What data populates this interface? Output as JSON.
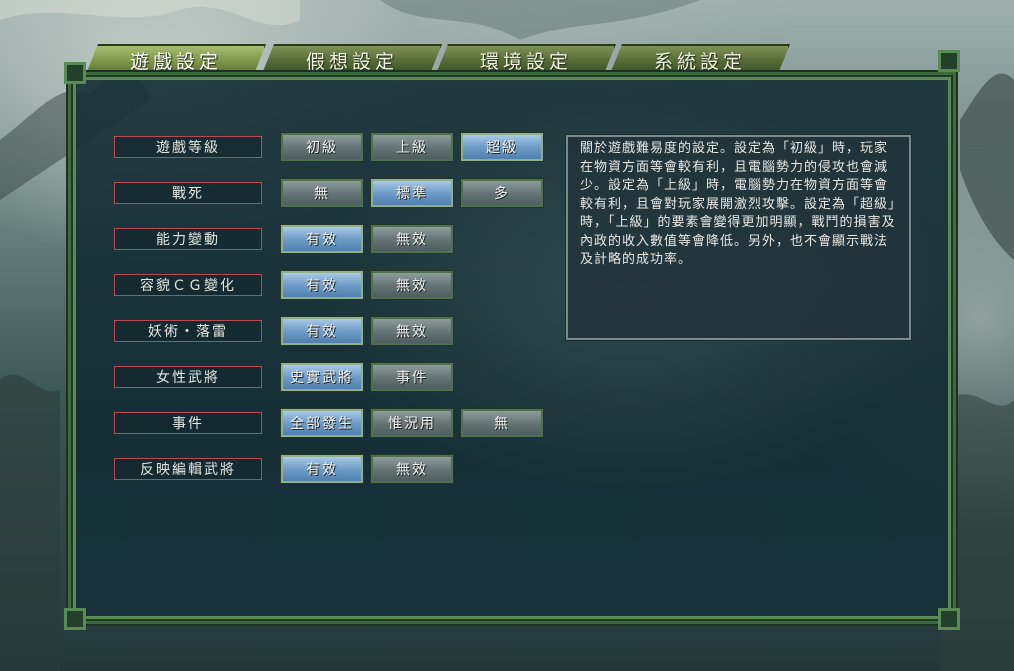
{
  "tabs": [
    {
      "label": "遊戲設定",
      "active": true
    },
    {
      "label": "假想設定",
      "active": false
    },
    {
      "label": "環境設定",
      "active": false
    },
    {
      "label": "系統設定",
      "active": false
    }
  ],
  "settings": [
    {
      "label": "遊戲等級",
      "options": [
        "初級",
        "上級",
        "超級"
      ],
      "selected": 2
    },
    {
      "label": "戰死",
      "options": [
        "無",
        "標準",
        "多"
      ],
      "selected": 1
    },
    {
      "label": "能力變動",
      "options": [
        "有效",
        "無效"
      ],
      "selected": 0
    },
    {
      "label": "容貌ＣＧ變化",
      "options": [
        "有效",
        "無效"
      ],
      "selected": 0
    },
    {
      "label": "妖術・落雷",
      "options": [
        "有效",
        "無效"
      ],
      "selected": 0
    },
    {
      "label": "女性武將",
      "options": [
        "史實武將",
        "事件"
      ],
      "selected": 0
    },
    {
      "label": "事件",
      "options": [
        "全部發生",
        "惟況用",
        "無"
      ],
      "selected": 0
    },
    {
      "label": "反映編輯武將",
      "options": [
        "有效",
        "無效"
      ],
      "selected": 0
    }
  ],
  "description": "關於遊戲難易度的設定。設定為「初級」時，玩家在物資方面等會較有利，且電腦勢力的侵攻也會減少。設定為「上級」時，電腦勢力在物資方面等會較有利，且會對玩家展開激烈攻擊。設定為「超級」時，「上級」的要素會變得更加明顯，戰鬥的損害及內政的收入數值等會降低。另外，也不會顯示戰法及計略的成功率。",
  "colors": {
    "tab_active": "#7e9649",
    "tab": "#556b36",
    "option_selected": "#6f9cc7",
    "option": "#667676",
    "label_border": "#b84a54",
    "frame": "#3d6a3c"
  },
  "icons": [
    "frame-corner-ornament"
  ]
}
